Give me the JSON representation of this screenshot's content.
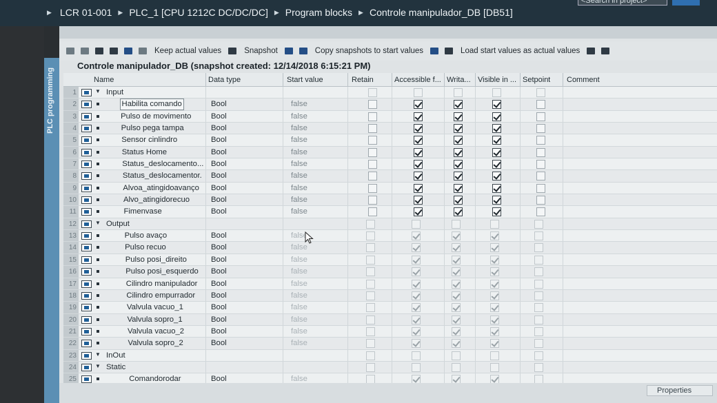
{
  "breadcrumb": [
    "LCR 01-001",
    "PLC_1 [CPU 1212C DC/DC/DC]",
    "Program blocks",
    "Controle manipulador_DB [DB51]"
  ],
  "search_placeholder": "<Search in project>",
  "sidetab_label": "PLC programming",
  "toolbar": {
    "keep_actual_values": "Keep actual values",
    "snapshot": "Snapshot",
    "copy_snapshots": "Copy snapshots to start values",
    "load_start_values": "Load start values as actual values"
  },
  "db_title": "Controle manipulador_DB (snapshot created: 12/14/2018 6:15:21 PM)",
  "columns": [
    "Name",
    "Data type",
    "Start value",
    "Retain",
    "Accessible f...",
    "Writa...",
    "Visible in ...",
    "Setpoint",
    "Comment"
  ],
  "rows": [
    {
      "n": "1",
      "name": "Input",
      "type": "",
      "start": "",
      "section": true,
      "retain": false,
      "acc": false,
      "wri": false,
      "vis": false,
      "set": false
    },
    {
      "n": "2",
      "name": "Habilita comando",
      "type": "Bool",
      "start": "false",
      "retain": false,
      "acc": true,
      "wri": true,
      "vis": true,
      "set": false
    },
    {
      "n": "3",
      "name": "Pulso de movimento",
      "type": "Bool",
      "start": "false",
      "retain": false,
      "acc": true,
      "wri": true,
      "vis": true,
      "set": false
    },
    {
      "n": "4",
      "name": "Pulso pega tampa",
      "type": "Bool",
      "start": "false",
      "retain": false,
      "acc": true,
      "wri": true,
      "vis": true,
      "set": false
    },
    {
      "n": "5",
      "name": "Sensor cinlindro",
      "type": "Bool",
      "start": "false",
      "retain": false,
      "acc": true,
      "wri": true,
      "vis": true,
      "set": false
    },
    {
      "n": "6",
      "name": "Status Home",
      "type": "Bool",
      "start": "false",
      "retain": false,
      "acc": true,
      "wri": true,
      "vis": true,
      "set": false
    },
    {
      "n": "7",
      "name": "Status_deslocamento...",
      "type": "Bool",
      "start": "false",
      "retain": false,
      "acc": true,
      "wri": true,
      "vis": true,
      "set": false
    },
    {
      "n": "8",
      "name": "Status_deslocamentor.",
      "type": "Bool",
      "start": "false",
      "retain": false,
      "acc": true,
      "wri": true,
      "vis": true,
      "set": false
    },
    {
      "n": "9",
      "name": "Alvoa_atingidoavanço",
      "type": "Bool",
      "start": "false",
      "retain": false,
      "acc": true,
      "wri": true,
      "vis": true,
      "set": false
    },
    {
      "n": "10",
      "name": "Alvo_atingidorecuo",
      "type": "Bool",
      "start": "false",
      "retain": false,
      "acc": true,
      "wri": true,
      "vis": true,
      "set": false
    },
    {
      "n": "11",
      "name": "Fimenvase",
      "type": "Bool",
      "start": "false",
      "retain": false,
      "acc": true,
      "wri": true,
      "vis": true,
      "set": false
    },
    {
      "n": "12",
      "name": "Output",
      "type": "",
      "start": "",
      "section": true,
      "retain": false,
      "acc": false,
      "wri": false,
      "vis": false,
      "set": false
    },
    {
      "n": "13",
      "name": "Pulso avaço",
      "type": "Bool",
      "start": "false",
      "retain": false,
      "acc": true,
      "wri": true,
      "vis": true,
      "set": false
    },
    {
      "n": "14",
      "name": "Pulso recuo",
      "type": "Bool",
      "start": "false",
      "retain": false,
      "acc": true,
      "wri": true,
      "vis": true,
      "set": false
    },
    {
      "n": "15",
      "name": "Pulso posi_direito",
      "type": "Bool",
      "start": "false",
      "retain": false,
      "acc": true,
      "wri": true,
      "vis": true,
      "set": false
    },
    {
      "n": "16",
      "name": "Pulso posi_esquerdo",
      "type": "Bool",
      "start": "false",
      "retain": false,
      "acc": true,
      "wri": true,
      "vis": true,
      "set": false
    },
    {
      "n": "17",
      "name": "Cilindro manipulador",
      "type": "Bool",
      "start": "false",
      "retain": false,
      "acc": true,
      "wri": true,
      "vis": true,
      "set": false
    },
    {
      "n": "18",
      "name": "Cilindro empurrador",
      "type": "Bool",
      "start": "false",
      "retain": false,
      "acc": true,
      "wri": true,
      "vis": true,
      "set": false
    },
    {
      "n": "19",
      "name": "Valvula vacuo_1",
      "type": "Bool",
      "start": "false",
      "retain": false,
      "acc": true,
      "wri": true,
      "vis": true,
      "set": false
    },
    {
      "n": "20",
      "name": "Valvula sopro_1",
      "type": "Bool",
      "start": "false",
      "retain": false,
      "acc": true,
      "wri": true,
      "vis": true,
      "set": false
    },
    {
      "n": "21",
      "name": "Valvula vacuo_2",
      "type": "Bool",
      "start": "false",
      "retain": false,
      "acc": true,
      "wri": true,
      "vis": true,
      "set": false
    },
    {
      "n": "22",
      "name": "Valvula sopro_2",
      "type": "Bool",
      "start": "false",
      "retain": false,
      "acc": true,
      "wri": true,
      "vis": true,
      "set": false
    },
    {
      "n": "23",
      "name": "InOut",
      "type": "",
      "start": "",
      "section": true,
      "retain": false,
      "acc": false,
      "wri": false,
      "vis": false,
      "set": false
    },
    {
      "n": "24",
      "name": "Static",
      "type": "",
      "start": "",
      "section": true,
      "retain": false,
      "acc": false,
      "wri": false,
      "vis": false,
      "set": false
    },
    {
      "n": "25",
      "name": "Comandorodar",
      "type": "Bool",
      "start": "false",
      "retain": false,
      "acc": true,
      "wri": true,
      "vis": true,
      "set": false
    }
  ],
  "properties_label": "Properties",
  "colors": {
    "topbar": "#22333e",
    "sidetab": "#5b8fb4",
    "editor": "#dfe3e5"
  }
}
